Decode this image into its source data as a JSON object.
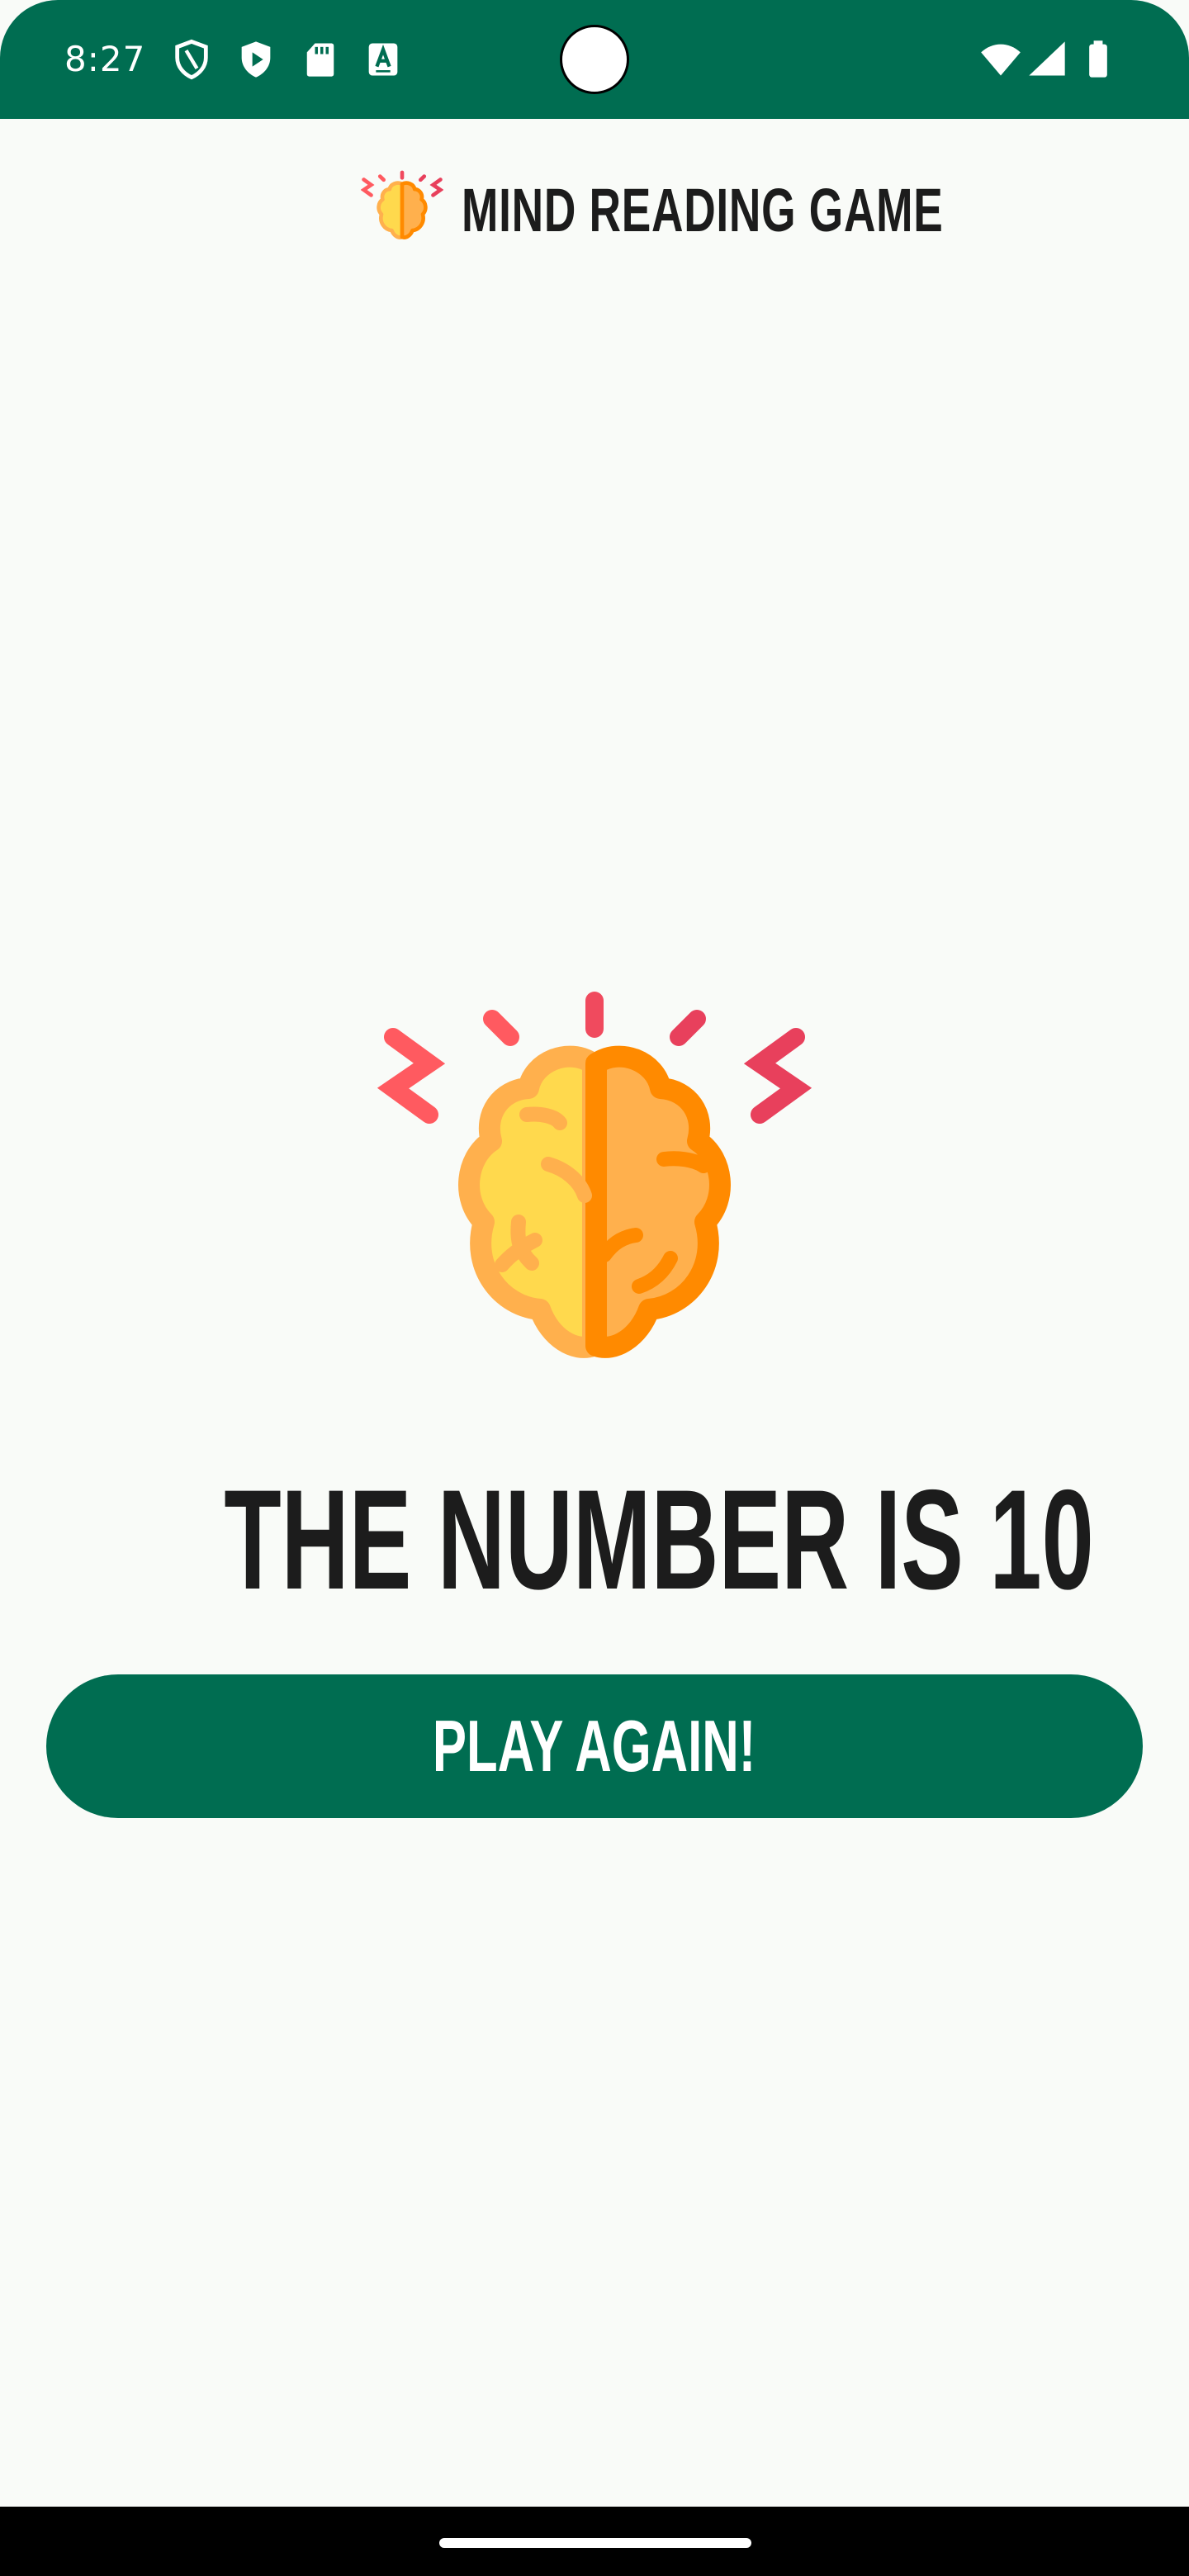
{
  "status_bar": {
    "time": "8:27",
    "icons": [
      "shield-outline-icon",
      "shield-play-icon",
      "sd-card-icon",
      "text-a-icon",
      "wifi-icon",
      "cell-signal-icon",
      "battery-icon"
    ]
  },
  "header": {
    "icon": "brain-icon",
    "title": "MIND READING GAME"
  },
  "main": {
    "illustration": "brain-icon",
    "result": "THE NUMBER IS 10",
    "play_again_label": "PLAY AGAIN!"
  },
  "colors": {
    "primary": "#006d51",
    "background": "#f9fbf8",
    "text": "#1c1c1c",
    "brain_yellow": "#ffd94d",
    "brain_orange": "#ffb04d",
    "brain_outline_left": "#ffb04d",
    "brain_outline_right": "#ff8a00",
    "spark_red": "#f0505c"
  }
}
